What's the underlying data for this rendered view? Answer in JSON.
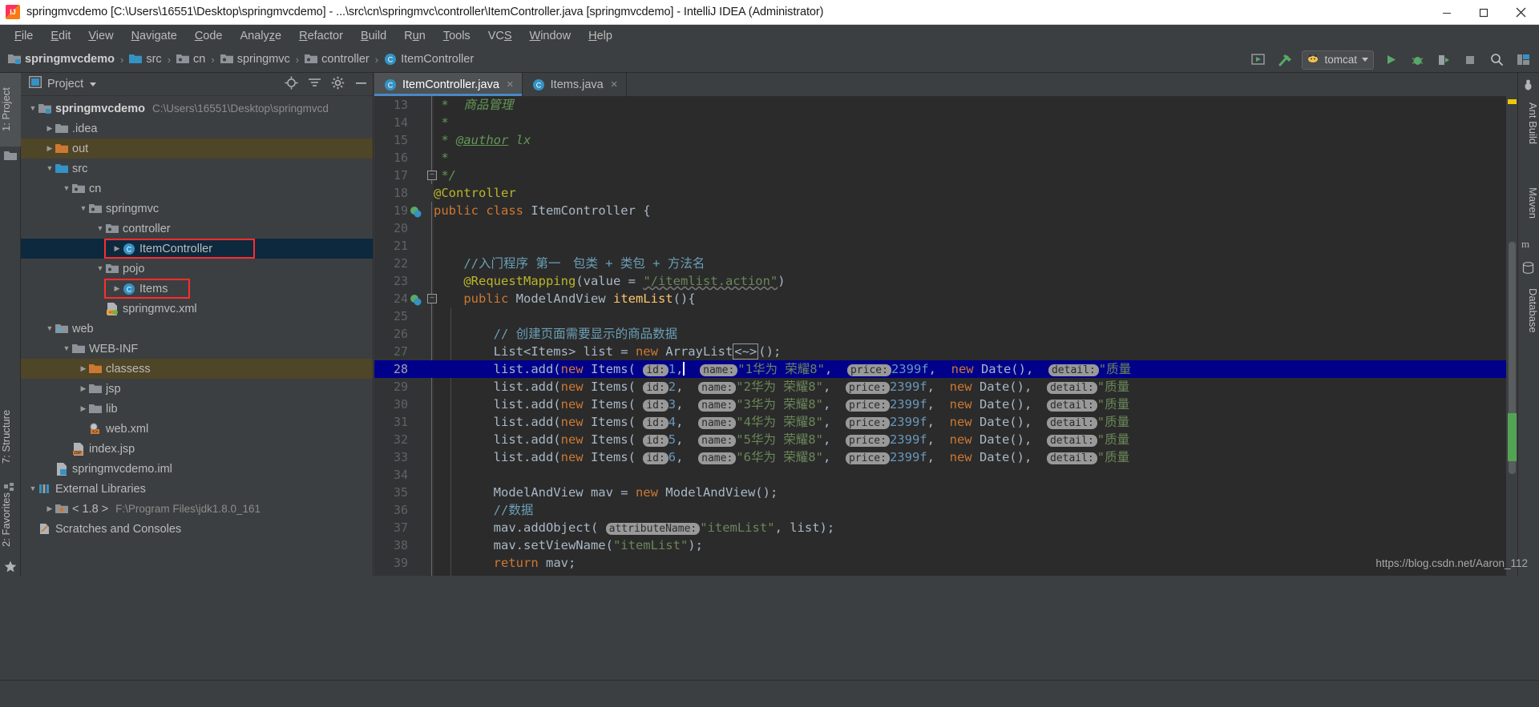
{
  "window": {
    "title": "springmvcdemo [C:\\Users\\16551\\Desktop\\springmvcdemo] - ...\\src\\cn\\springmvc\\controller\\ItemController.java [springmvcdemo] - IntelliJ IDEA (Administrator)",
    "app_icon": "intellij-idea-icon",
    "minimize_label": "Minimize",
    "maximize_label": "Restore",
    "close_label": "Close"
  },
  "menubar": {
    "items": [
      {
        "label": "File",
        "mnemonic": "F"
      },
      {
        "label": "Edit",
        "mnemonic": "E"
      },
      {
        "label": "View",
        "mnemonic": "V"
      },
      {
        "label": "Navigate",
        "mnemonic": "N"
      },
      {
        "label": "Code",
        "mnemonic": "C"
      },
      {
        "label": "Analyze",
        "mnemonic": "z"
      },
      {
        "label": "Refactor",
        "mnemonic": "R"
      },
      {
        "label": "Build",
        "mnemonic": "B"
      },
      {
        "label": "Run",
        "mnemonic": "u"
      },
      {
        "label": "Tools",
        "mnemonic": "T"
      },
      {
        "label": "VCS",
        "mnemonic": "S"
      },
      {
        "label": "Window",
        "mnemonic": "W"
      },
      {
        "label": "Help",
        "mnemonic": "H"
      }
    ]
  },
  "breadcrumb": {
    "items": [
      {
        "label": "springmvcdemo",
        "icon": "module-folder-icon"
      },
      {
        "label": "src",
        "icon": "source-folder-icon"
      },
      {
        "label": "cn",
        "icon": "package-folder-icon"
      },
      {
        "label": "springmvc",
        "icon": "package-folder-icon"
      },
      {
        "label": "controller",
        "icon": "package-folder-icon"
      },
      {
        "label": "ItemController",
        "icon": "java-class-icon"
      }
    ],
    "separator": "›"
  },
  "toolbar": {
    "run_config_label": "tomcat",
    "run_config_icon": "tomcat-cat-icon",
    "buttons": [
      {
        "name": "open-in-browser-icon",
        "title": "Open in browser"
      },
      {
        "name": "build-hammer-icon",
        "title": "Build Project"
      },
      {
        "name": "run-icon",
        "title": "Run"
      },
      {
        "name": "debug-icon",
        "title": "Debug"
      },
      {
        "name": "run-coverage-icon",
        "title": "Run with Coverage"
      },
      {
        "name": "stop-icon",
        "title": "Stop"
      },
      {
        "name": "search-everywhere-icon",
        "title": "Search Everywhere"
      },
      {
        "name": "layout-icon",
        "title": "Layout"
      }
    ]
  },
  "left_tool_strip": {
    "tabs": [
      {
        "label": "1: Project",
        "mnemonic": "1",
        "active": true
      },
      {
        "label": "7: Structure",
        "mnemonic": "7",
        "active": false
      },
      {
        "label": "2: Favorites",
        "mnemonic": "2",
        "active": false
      }
    ]
  },
  "right_tool_strip": {
    "tabs": [
      {
        "label": "Ant Build",
        "icon": "ant-icon"
      },
      {
        "label": "Maven",
        "icon": "maven-icon"
      },
      {
        "label": "Database",
        "icon": "database-icon"
      }
    ]
  },
  "project_panel": {
    "title": "Project",
    "actions": [
      {
        "name": "locate-target-icon"
      },
      {
        "name": "collapse-all-icon"
      },
      {
        "name": "settings-gear-icon"
      },
      {
        "name": "hide-panel-icon"
      }
    ],
    "tree": [
      {
        "label": "springmvcdemo",
        "sub": "C:\\Users\\16551\\Desktop\\springmvcd",
        "depth": 0,
        "arrow": "▼",
        "icon": "module-folder-icon",
        "bold": true,
        "state": "normal"
      },
      {
        "label": ".idea",
        "sub": "",
        "depth": 1,
        "arrow": "▶",
        "icon": "folder-gray-icon",
        "bold": false,
        "state": "normal"
      },
      {
        "label": "out",
        "sub": "",
        "depth": 1,
        "arrow": "▶",
        "icon": "folder-orange-icon",
        "bold": false,
        "state": "excluded"
      },
      {
        "label": "src",
        "sub": "",
        "depth": 1,
        "arrow": "▼",
        "icon": "folder-blue-icon",
        "bold": false,
        "state": "normal"
      },
      {
        "label": "cn",
        "sub": "",
        "depth": 2,
        "arrow": "▼",
        "icon": "package-folder-icon",
        "bold": false,
        "state": "normal"
      },
      {
        "label": "springmvc",
        "sub": "",
        "depth": 3,
        "arrow": "▼",
        "icon": "package-folder-icon",
        "bold": false,
        "state": "normal"
      },
      {
        "label": "controller",
        "sub": "",
        "depth": 4,
        "arrow": "▼",
        "icon": "package-folder-icon",
        "bold": false,
        "state": "normal"
      },
      {
        "label": "ItemController",
        "sub": "",
        "depth": 5,
        "arrow": "▶",
        "icon": "java-class-icon",
        "bold": false,
        "state": "selected-highlighted"
      },
      {
        "label": "pojo",
        "sub": "",
        "depth": 4,
        "arrow": "▼",
        "icon": "package-folder-icon",
        "bold": false,
        "state": "normal"
      },
      {
        "label": "Items",
        "sub": "",
        "depth": 5,
        "arrow": "▶",
        "icon": "java-class-icon",
        "bold": false,
        "state": "highlighted"
      },
      {
        "label": "springmvc.xml",
        "sub": "",
        "depth": 4,
        "arrow": "",
        "icon": "spring-xml-icon",
        "bold": false,
        "state": "normal"
      },
      {
        "label": "web",
        "sub": "",
        "depth": 1,
        "arrow": "▼",
        "icon": "web-folder-icon",
        "bold": false,
        "state": "normal"
      },
      {
        "label": "WEB-INF",
        "sub": "",
        "depth": 2,
        "arrow": "▼",
        "icon": "folder-gray-icon",
        "bold": false,
        "state": "normal"
      },
      {
        "label": "classess",
        "sub": "",
        "depth": 3,
        "arrow": "▶",
        "icon": "folder-orange-icon",
        "bold": false,
        "state": "excluded"
      },
      {
        "label": "jsp",
        "sub": "",
        "depth": 3,
        "arrow": "▶",
        "icon": "folder-gray-icon",
        "bold": false,
        "state": "normal"
      },
      {
        "label": "lib",
        "sub": "",
        "depth": 3,
        "arrow": "▶",
        "icon": "folder-gray-icon",
        "bold": false,
        "state": "normal"
      },
      {
        "label": "web.xml",
        "sub": "",
        "depth": 3,
        "arrow": "",
        "icon": "web-xml-icon",
        "bold": false,
        "state": "normal"
      },
      {
        "label": "index.jsp",
        "sub": "",
        "depth": 2,
        "arrow": "",
        "icon": "jsp-file-icon",
        "bold": false,
        "state": "normal"
      },
      {
        "label": "springmvcdemo.iml",
        "sub": "",
        "depth": 1,
        "arrow": "",
        "icon": "iml-file-icon",
        "bold": false,
        "state": "normal"
      },
      {
        "label": "External Libraries",
        "sub": "",
        "depth": 0,
        "arrow": "▼",
        "icon": "external-libraries-icon",
        "bold": false,
        "state": "normal"
      },
      {
        "label": "< 1.8 >",
        "sub": "F:\\Program Files\\jdk1.8.0_161",
        "depth": 1,
        "arrow": "▶",
        "icon": "jdk-icon",
        "bold": false,
        "state": "normal"
      },
      {
        "label": "Scratches and Consoles",
        "sub": "",
        "depth": 0,
        "arrow": "",
        "icon": "scratches-icon",
        "bold": false,
        "state": "normal"
      }
    ]
  },
  "editor": {
    "tabs": [
      {
        "label": "ItemController.java",
        "icon": "java-class-icon",
        "active": true,
        "close": "×"
      },
      {
        "label": "Items.java",
        "icon": "java-class-icon",
        "active": false,
        "close": "×"
      }
    ],
    "first_line_number": 13,
    "highlighted_line": 28,
    "lines": [
      {
        "no": 13,
        "text": " *  商品管理"
      },
      {
        "no": 14,
        "text": " *"
      },
      {
        "no": 15,
        "text": " * @author lx"
      },
      {
        "no": 16,
        "text": " *"
      },
      {
        "no": 17,
        "text": " */"
      },
      {
        "no": 18,
        "text": "@Controller"
      },
      {
        "no": 19,
        "text": "public class ItemController {"
      },
      {
        "no": 20,
        "text": ""
      },
      {
        "no": 21,
        "text": ""
      },
      {
        "no": 22,
        "text": "    //入门程序 第一　包类 + 类包 + 方法名"
      },
      {
        "no": 23,
        "text": "    @RequestMapping(value = \"/itemlist.action\")"
      },
      {
        "no": 24,
        "text": "    public ModelAndView itemList(){"
      },
      {
        "no": 25,
        "text": ""
      },
      {
        "no": 26,
        "text": "        // 创建页面需要显示的商品数据"
      },
      {
        "no": 27,
        "text": "        List<Items> list = new ArrayList<~>();"
      },
      {
        "no": 28,
        "text": "        list.add(new Items( id: 1, name: \"1华为 荣耀8\", price: 2399f, new Date(), detail: \"质量"
      },
      {
        "no": 29,
        "text": "        list.add(new Items( id: 2, name: \"2华为 荣耀8\", price: 2399f, new Date(), detail: \"质量"
      },
      {
        "no": 30,
        "text": "        list.add(new Items( id: 3, name: \"3华为 荣耀8\", price: 2399f, new Date(), detail: \"质量"
      },
      {
        "no": 31,
        "text": "        list.add(new Items( id: 4, name: \"4华为 荣耀8\", price: 2399f, new Date(), detail: \"质量"
      },
      {
        "no": 32,
        "text": "        list.add(new Items( id: 5, name: \"5华为 荣耀8\", price: 2399f, new Date(), detail: \"质量"
      },
      {
        "no": 33,
        "text": "        list.add(new Items( id: 6, name: \"6华为 荣耀8\", price: 2399f, new Date(), detail: \"质量"
      },
      {
        "no": 34,
        "text": ""
      },
      {
        "no": 35,
        "text": "        ModelAndView mav = new ModelAndView();"
      },
      {
        "no": 36,
        "text": "        //数据"
      },
      {
        "no": 37,
        "text": "        mav.addObject( attributeName: \"itemList\", list);"
      },
      {
        "no": 38,
        "text": "        mav.setViewName(\"itemList\");"
      },
      {
        "no": 39,
        "text": "        return mav;"
      }
    ],
    "item_rows": [
      {
        "id": "1",
        "name": "\"1华为 荣耀8\"",
        "price": "2399f",
        "detail": "\"质量"
      },
      {
        "id": "2",
        "name": "\"2华为 荣耀8\"",
        "price": "2399f",
        "detail": "\"质量"
      },
      {
        "id": "3",
        "name": "\"3华为 荣耀8\"",
        "price": "2399f",
        "detail": "\"质量"
      },
      {
        "id": "4",
        "name": "\"4华为 荣耀8\"",
        "price": "2399f",
        "detail": "\"质量"
      },
      {
        "id": "5",
        "name": "\"5华为 荣耀8\"",
        "price": "2399f",
        "detail": "\"质量"
      },
      {
        "id": "6",
        "name": "\"6华为 荣耀8\"",
        "price": "2399f",
        "detail": "\"质量"
      }
    ],
    "hints": {
      "id": "id:",
      "name": "name:",
      "price": "price:",
      "detail": "detail:",
      "attribute_name": "attributeName:"
    }
  },
  "status_bar": {
    "watermark": "https://blog.csdn.net/Aaron_112"
  },
  "colors": {
    "accent_blue": "#4a88c7",
    "selection_blue": "#0d293e",
    "highlight_line": "#00008b",
    "annotation_red": "#ff2c2c",
    "excluded_folder": "#4f4527",
    "keyword_orange": "#cc7832",
    "string_green": "#6a8759",
    "number_blue": "#6897bb",
    "comment_green": "#629755",
    "method_yellow": "#ffc66d",
    "annotation_yellow": "#bbb529"
  }
}
